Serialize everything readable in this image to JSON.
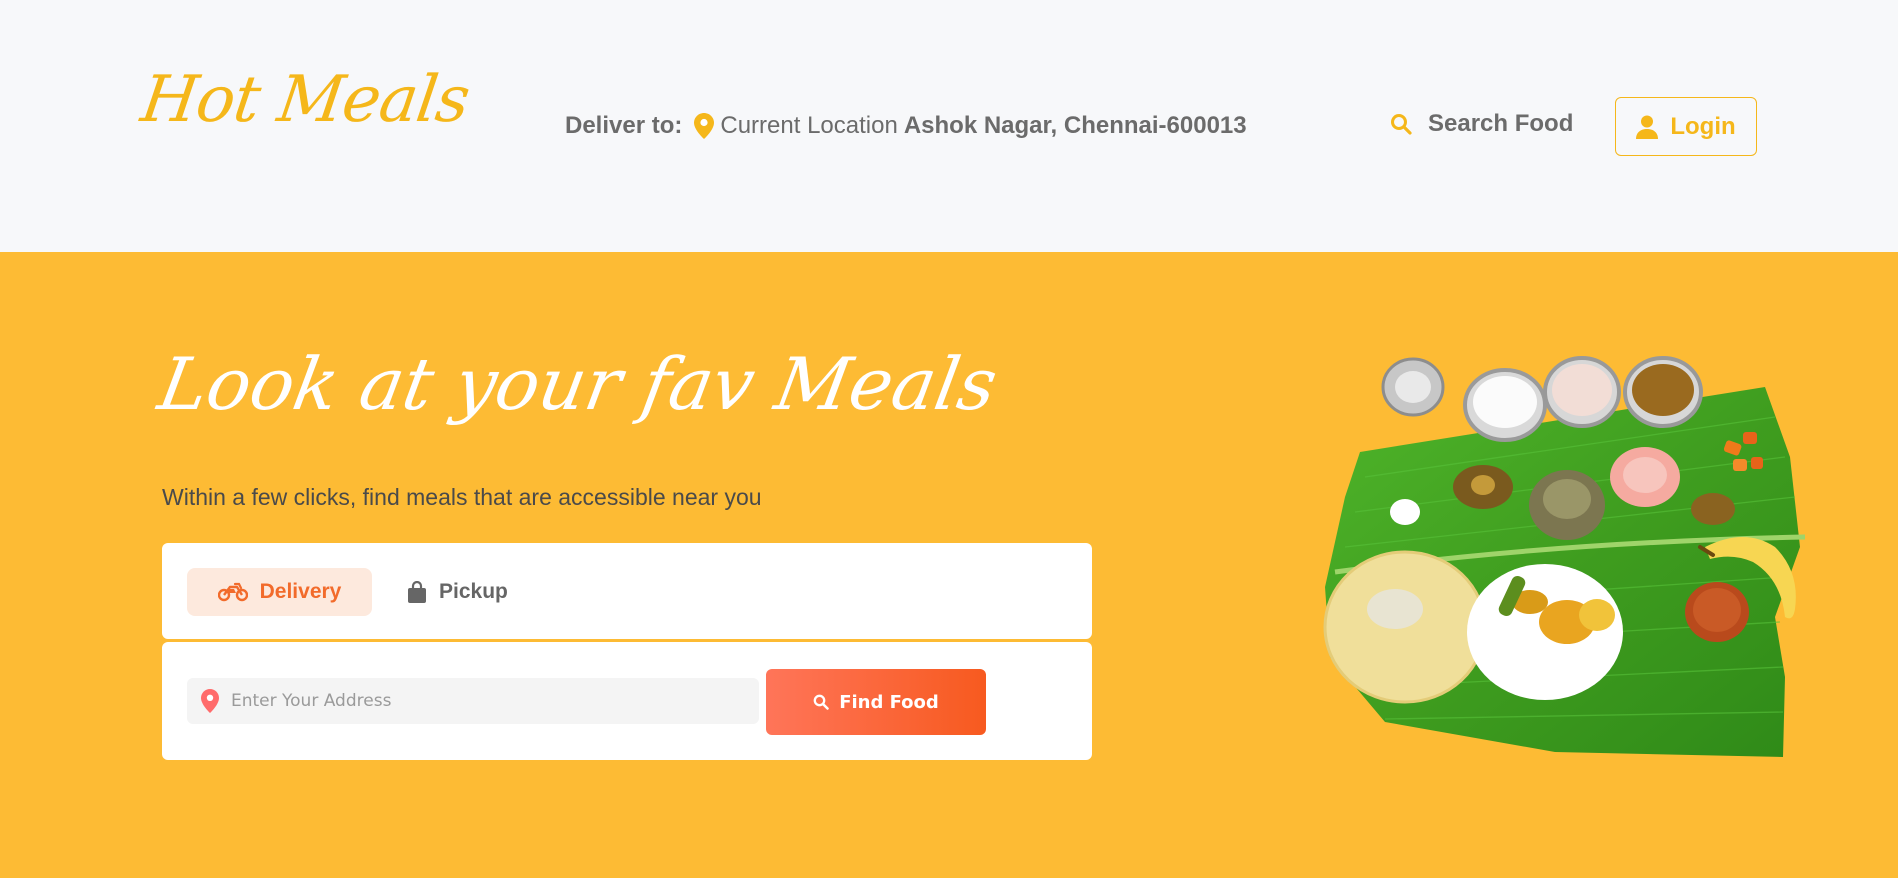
{
  "brand": {
    "logo_text": "Hot Meals",
    "color": "#f5b71a"
  },
  "header": {
    "deliver_label": "Deliver to:",
    "location_prefix": "Current Location",
    "location_address": "Ashok Nagar, Chennai-600013",
    "search_label": "Search Food",
    "login_label": "Login"
  },
  "hero": {
    "title": "Look at your fav Meals",
    "subtitle": "Within a few clicks, find meals that are accessible near you",
    "background": "#fdbb34",
    "tabs": [
      {
        "label": "Delivery",
        "icon": "motorcycle-icon",
        "active": true
      },
      {
        "label": "Pickup",
        "icon": "shopping-bag-icon",
        "active": false
      }
    ],
    "address_placeholder": "Enter Your Address",
    "find_button_label": "Find Food"
  },
  "colors": {
    "accent": "#f26b2b",
    "yellow": "#fdbb34"
  }
}
